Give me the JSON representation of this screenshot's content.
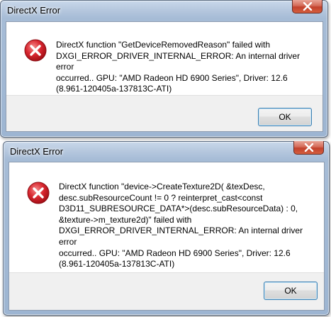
{
  "dialogs": [
    {
      "title": "DirectX Error",
      "icon": "error-icon",
      "message": "DirectX function \"GetDeviceRemovedReason\" failed with\nDXGI_ERROR_DRIVER_INTERNAL_ERROR: An internal driver error\noccurred.. GPU: \"AMD Radeon HD 6900 Series\", Driver: 12.6\n(8.961-120405a-137813C-ATI)",
      "ok_label": "OK"
    },
    {
      "title": "DirectX Error",
      "icon": "error-icon",
      "message": "DirectX function \"device->CreateTexture2D( &texDesc,\ndesc.subResourceCount != 0 ? reinterpret_cast<const\nD3D11_SUBRESOURCE_DATA*>(desc.subResourceData) : 0,\n&texture->m_texture2d)\" failed with\nDXGI_ERROR_DRIVER_INTERNAL_ERROR: An internal driver error\noccurred.. GPU: \"AMD Radeon HD 6900 Series\", Driver: 12.6\n(8.961-120405a-137813C-ATI)",
      "ok_label": "OK"
    }
  ],
  "colors": {
    "error_red": "#d8262f",
    "close_button": "#c2412c",
    "frame": "#a6bcd6"
  }
}
